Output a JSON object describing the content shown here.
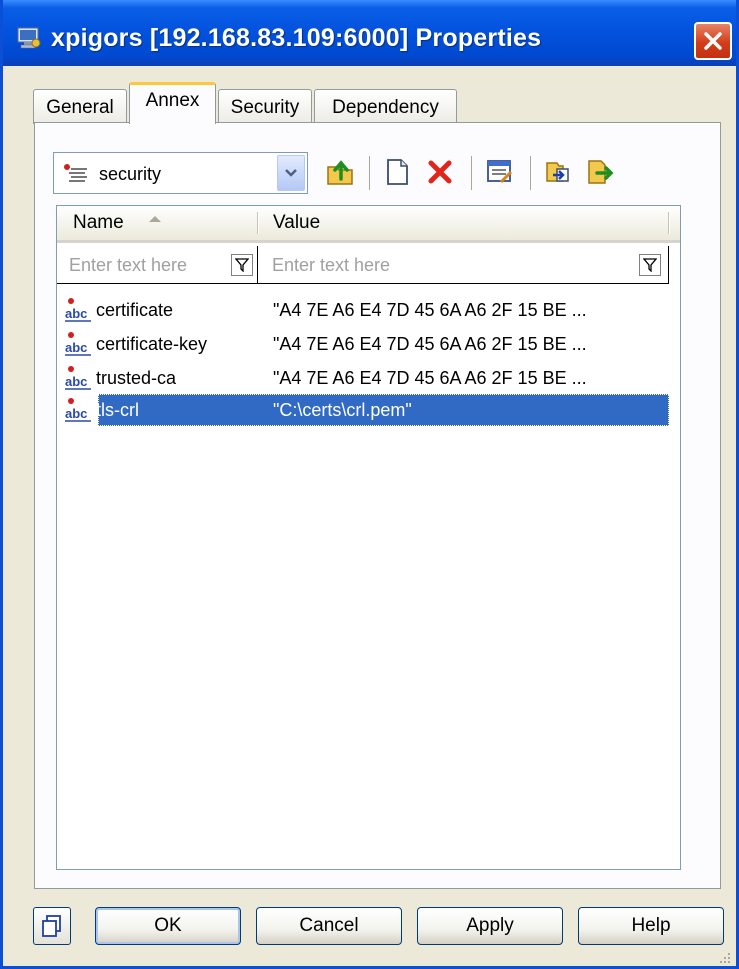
{
  "window": {
    "title": "xpigors [192.168.83.109:6000] Properties",
    "close_icon": "close-icon"
  },
  "tabs": [
    {
      "label": "General",
      "active": false
    },
    {
      "label": "Annex",
      "active": true
    },
    {
      "label": "Security",
      "active": false
    },
    {
      "label": "Dependency",
      "active": false
    }
  ],
  "annex": {
    "category": "security",
    "toolbar": [
      "up-folder-icon",
      "new-document-icon",
      "delete-icon",
      "edit-properties-icon",
      "import-icon",
      "export-icon"
    ]
  },
  "list": {
    "columns": {
      "name": "Name",
      "value": "Value"
    },
    "filter_placeholder": "Enter text here",
    "rows": [
      {
        "name": "certificate",
        "value": "\"A4 7E A6 E4 7D 45 6A A6 2F 15 BE ...",
        "selected": false
      },
      {
        "name": "certificate-key",
        "value": "\"A4 7E A6 E4 7D 45 6A A6 2F 15 BE ...",
        "selected": false
      },
      {
        "name": "trusted-ca",
        "value": "\"A4 7E A6 E4 7D 45 6A A6 2F 15 BE ...",
        "selected": false
      },
      {
        "name": "tls-crl",
        "value": "\"C:\\certs\\crl.pem\"",
        "selected": true
      }
    ]
  },
  "buttons": {
    "ok": "OK",
    "cancel": "Cancel",
    "apply": "Apply",
    "help": "Help"
  },
  "colors": {
    "titlebar": "#0454e0",
    "selection": "#316ac5",
    "close": "#d43d1a"
  }
}
